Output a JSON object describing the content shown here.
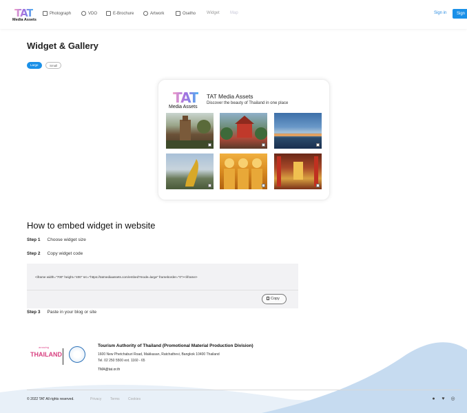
{
  "nav": {
    "logo_tat": "TAT",
    "logo_sub": "Media Assets",
    "items": [
      {
        "label": "Photograph",
        "icon": "image-icon"
      },
      {
        "label": "VDO",
        "icon": "play-icon"
      },
      {
        "label": "E-Brochure",
        "icon": "book-icon"
      },
      {
        "label": "Artwork",
        "icon": "palette-icon"
      },
      {
        "label": "Oselho",
        "icon": "document-icon"
      },
      {
        "label": "Widget"
      },
      {
        "label": "Map"
      }
    ],
    "sign_in": "Sign in",
    "sign_up": "Sign"
  },
  "header": {
    "title": "Widget & Gallery",
    "size_large": "Large",
    "size_small": "Small"
  },
  "widget": {
    "logo_tat": "TAT",
    "logo_sub": "Media Assets",
    "title": "TAT Media Assets",
    "subtitle": "Discover the beauty of Thailand in one place"
  },
  "embed": {
    "heading": "How to embed widget in website",
    "step1_label": "Step 1",
    "step1_text": "Choose widget size",
    "step2_label": "Step 2",
    "step2_text": "Copy widget code",
    "code": "<iframe width=\"700\" height=\"400\" src=\"https://tatmediaassets.com/embed?mode=large\" frameborder=\"0\"></iframe>",
    "copy_label": "Copy",
    "step3_label": "Step 3",
    "step3_text": "Paste in your blog or site"
  },
  "footer": {
    "amazing": "amazing",
    "thailand": "THAILAND",
    "org": "Tourism Authority of Thailand (Promotional Material Production Division)",
    "address": "1600 New Phetchaburi Road, Makkasan, Ratchathevi, Bangkok 10400 Thailand",
    "tel": "Tel. 02 250 5500 ext. 1160 - 65",
    "email": "TMA@tat.or.th",
    "copyright": "© 2022 TAT All rights reserved.",
    "privacy": "Privacy",
    "terms": "Terms",
    "cookies": "Cookies"
  },
  "colors": {
    "accent": "#1a90e8"
  }
}
